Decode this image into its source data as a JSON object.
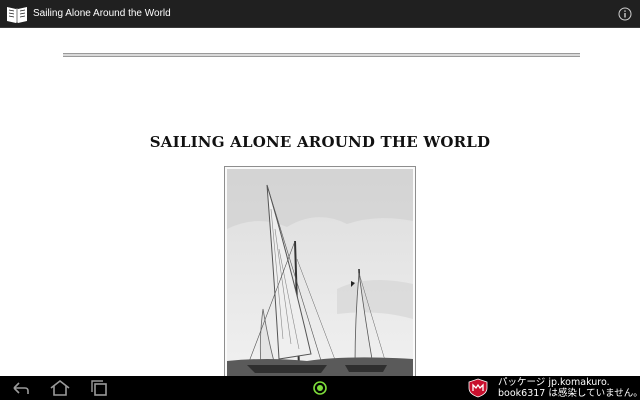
{
  "action_bar": {
    "title": "Sailing Alone Around the World",
    "app_icon": "book-icon",
    "overflow_icon": "info-icon"
  },
  "book": {
    "title": "SAILING ALONE AROUND THE WORLD",
    "frontispiece": "sailboat-illustration"
  },
  "nav_bar": {
    "buttons": [
      "back-icon",
      "home-icon",
      "recent-apps-icon"
    ],
    "center_indicator": "status-dot-icon"
  },
  "notification": {
    "icon": "antivirus-shield-icon",
    "line1": "パッケージ jp.komakuro.",
    "line2": "book6317 は感染していません。"
  },
  "colors": {
    "action_bar_bg": "#202020",
    "nav_bar_bg": "#000000",
    "accent_green": "#7ddc3a",
    "shield_red": "#c8102e"
  }
}
